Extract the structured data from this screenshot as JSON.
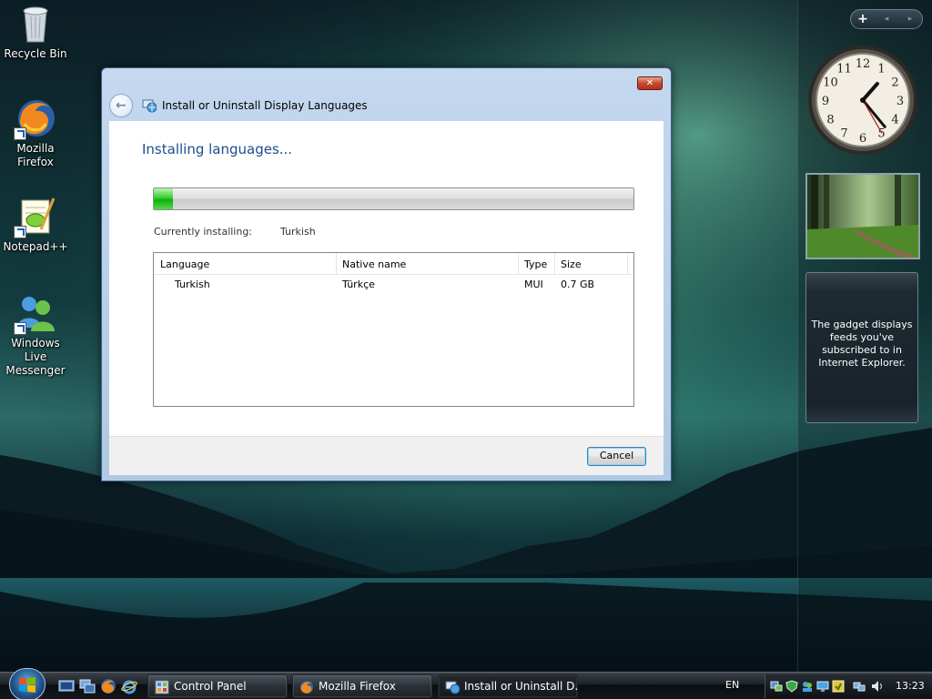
{
  "desktop": {
    "icons": [
      {
        "label": "Recycle Bin"
      },
      {
        "label": "Mozilla Firefox"
      },
      {
        "label": "Notepad++"
      },
      {
        "label": "Windows Live Messenger"
      }
    ]
  },
  "sidebar": {
    "controls": {
      "add": "+",
      "prev": "◂",
      "next": "▸"
    },
    "clock": {
      "hour": 1,
      "minute": 23,
      "second": 25
    },
    "feeds_text": "The gadget displays feeds you've subscribed to in Internet Explorer."
  },
  "dialog": {
    "title": "Install or Uninstall Display Languages",
    "close_label": "✕",
    "heading": "Installing languages...",
    "progress": 0.04,
    "currently_installing_label": "Currently installing:",
    "currently_installing_value": "Turkish",
    "columns": [
      "Language",
      "Native name",
      "Type",
      "Size"
    ],
    "rows": [
      {
        "language": "Turkish",
        "native": "Türkçe",
        "type": "MUI",
        "size": "0.7 GB"
      }
    ],
    "cancel_label": "Cancel"
  },
  "taskbar": {
    "buttons": [
      {
        "label": "Control Panel",
        "icon": "control-panel-icon",
        "active": false
      },
      {
        "label": "Mozilla Firefox",
        "icon": "firefox-icon",
        "active": false
      },
      {
        "label": "Install or Uninstall D...",
        "icon": "language-icon",
        "active": true
      }
    ],
    "language": "EN",
    "time": "13:23"
  },
  "colors": {
    "heading": "#1e4b8f",
    "progress_fill": "#0eb00b",
    "dialog_frame": "#c4d8ee",
    "aurora": "#3fae7a"
  }
}
